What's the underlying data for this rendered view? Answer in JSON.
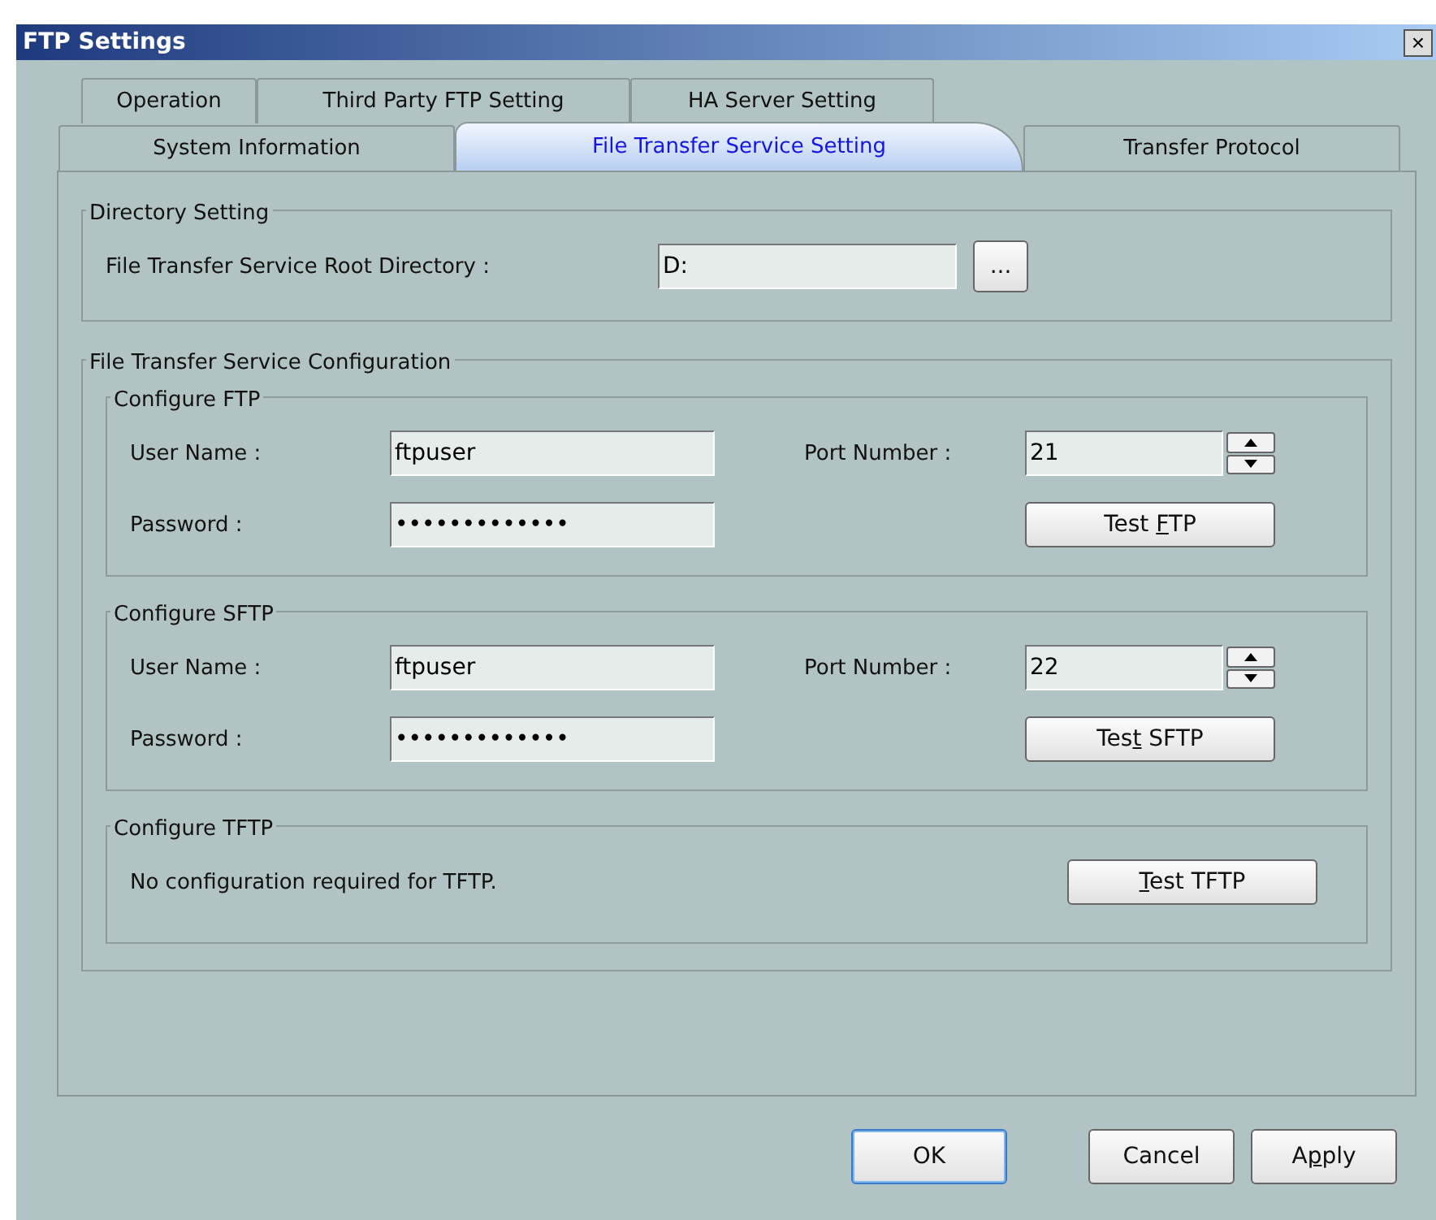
{
  "window": {
    "title": "FTP Settings",
    "close": "×"
  },
  "tab_rows": [
    [
      {
        "label": "Operation",
        "selected": false
      },
      {
        "label": "Third Party FTP Setting",
        "selected": false
      },
      {
        "label": "HA Server Setting",
        "selected": false
      }
    ],
    [
      {
        "label": "System Information",
        "selected": false
      },
      {
        "label": "File Transfer Service Setting",
        "selected": true
      },
      {
        "label": "Transfer Protocol",
        "selected": false
      }
    ]
  ],
  "directory": {
    "title": "Directory Setting",
    "label": "File Transfer Service Root Directory :",
    "value": "D:",
    "browse": "..."
  },
  "configuration": {
    "title": "File Transfer Service Configuration",
    "groups": [
      {
        "kind": "credentials",
        "title": "Configure FTP",
        "user_label": "User Name :",
        "user": "ftpuser",
        "password_label": "Password :",
        "password": "•••••••••••••",
        "port_label": "Port Number :",
        "port": "21",
        "test": [
          {
            "text": "Test "
          },
          {
            "text": "F",
            "key": true
          },
          {
            "text": "TP"
          }
        ]
      },
      {
        "kind": "credentials",
        "title": "Configure SFTP",
        "user_label": "User Name :",
        "user": "ftpuser",
        "password_label": "Password :",
        "password": "•••••••••••••",
        "port_label": "Port Number :",
        "port": "22",
        "test": [
          {
            "text": "Tes"
          },
          {
            "text": "t",
            "key": true
          },
          {
            "text": " SFTP"
          }
        ]
      },
      {
        "kind": "note",
        "title": "Configure TFTP",
        "note": "No configuration required for TFTP.",
        "test": [
          {
            "text": "T",
            "key": true
          },
          {
            "text": "est TFTP"
          }
        ]
      }
    ]
  },
  "buttons": [
    {
      "label": [
        {
          "text": "OK"
        }
      ],
      "default": true
    },
    {
      "label": [
        {
          "text": "Cancel"
        }
      ],
      "default": false
    },
    {
      "label": [
        {
          "text": "A"
        },
        {
          "text": "p",
          "key": true
        },
        {
          "text": "ply"
        }
      ],
      "default": false
    }
  ]
}
